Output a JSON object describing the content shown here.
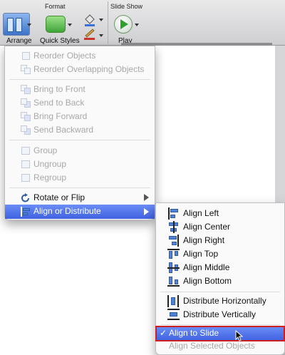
{
  "ribbon": {
    "groups": {
      "format_label": "Format",
      "slideshow_label": "Slide Show"
    },
    "buttons": {
      "arrange": "Arrange",
      "quick_styles": "Quick Styles",
      "play": "Play"
    }
  },
  "arrange_menu": {
    "items": [
      {
        "label": "Reorder Objects",
        "enabled": false
      },
      {
        "label": "Reorder Overlapping Objects",
        "enabled": false
      },
      {
        "label": "Bring to Front",
        "enabled": false
      },
      {
        "label": "Send to Back",
        "enabled": false
      },
      {
        "label": "Bring Forward",
        "enabled": false
      },
      {
        "label": "Send Backward",
        "enabled": false
      },
      {
        "label": "Group",
        "enabled": false
      },
      {
        "label": "Ungroup",
        "enabled": false
      },
      {
        "label": "Regroup",
        "enabled": false
      },
      {
        "label": "Rotate or Flip",
        "enabled": true
      },
      {
        "label": "Align or Distribute",
        "enabled": true,
        "highlighted": true
      }
    ]
  },
  "align_submenu": {
    "items": [
      {
        "label": "Align Left"
      },
      {
        "label": "Align Center"
      },
      {
        "label": "Align Right"
      },
      {
        "label": "Align Top"
      },
      {
        "label": "Align Middle"
      },
      {
        "label": "Align Bottom"
      },
      {
        "label": "Distribute Horizontally"
      },
      {
        "label": "Distribute Vertically"
      },
      {
        "label": "Align to Slide",
        "checked": true,
        "highlighted": true
      },
      {
        "label": "Align Selected Objects",
        "enabled": false
      }
    ],
    "check_mark": "✓"
  },
  "colors": {
    "highlight": "#4a6ee8",
    "highlight_border": "#cc1f1f",
    "disabled_text": "#a8a8a8"
  }
}
